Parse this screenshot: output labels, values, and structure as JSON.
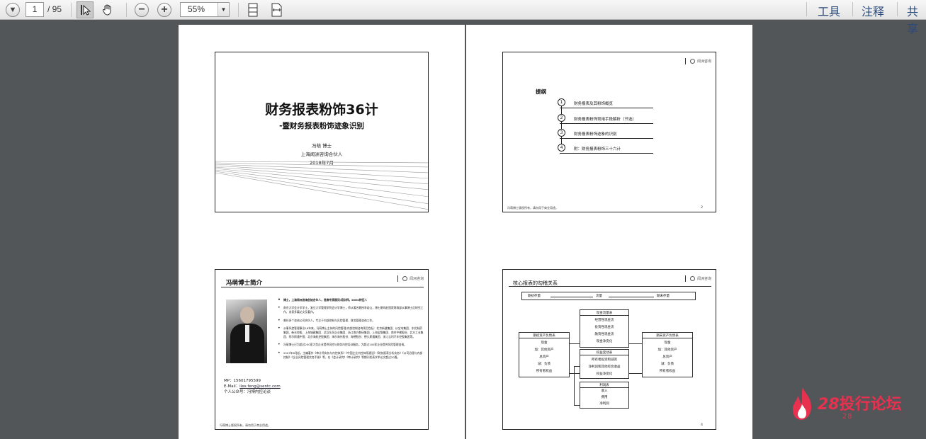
{
  "toolbar": {
    "page_current": "1",
    "page_total": "/ 95",
    "zoom": "55%",
    "menus": [
      "工具",
      "注释",
      "共享"
    ]
  },
  "slide1": {
    "title": "财务报表粉饰36计",
    "subtitle": "-暨财务报表粉饰迹象识别",
    "author": "冯萌 博士",
    "org": "上海闻洲咨询合伙人",
    "date": "2018年7月"
  },
  "slide2": {
    "heading": "提纲",
    "items": [
      {
        "num": "1",
        "text": "财务报表及其粉饰概览"
      },
      {
        "num": "2",
        "text": "财务报表粉饰常用手段解析（节选）"
      },
      {
        "num": "3",
        "text": "财务报表粉饰迹象的识别"
      },
      {
        "num": "4",
        "text": "附：财务报表粉饰三十六计"
      }
    ],
    "page_no": "2"
  },
  "slide3": {
    "title": "冯萌博士简介",
    "contact_mp": "MP：15601795599",
    "contact_email_label": "E-Mail：",
    "contact_email": "ilex.feng@sentc.com",
    "contact_wechat": "个人公众号：冯博内控论谈",
    "bullets": [
      "博士，上海闻洲咨询创始合伙人，首席专家顾问/培训师，DIOS特征人",
      "南京大学会计学学士，复旦大学管理学院会计学博士，师从著名教授李若山，博士期间赴国家财政部从事博士后研究工作，发表多篇论文及著作。",
      "曾任多个咨询公司合伙人，专注于内部控制与风险管理、财务管理咨询工作。",
      "从事风控管理事业16年来，冯萌博士主持的风险管理/内部控制咨询项目包括：北京新道集团、炒宝岛集团、东北制药集团、新光控股、上海城建集团、武汉东风企业集团、浙江南方数码集团、上海宝钢集团、南京中粮股份、北方工业集团、阿尔斯通中国、北京海航控股集团、海尔海外股份、海德股份、德久斯通集团、浙江吉利汽车控股集团等。",
      "冯萌博士已为超过200家大型企业提供风控与财务内控培训服务，为超过100家企业提供风险管理咨询。",
      "2007年8月起，主编著作《审计师实务与内控体系》《中国企业内控体系建设》《财务报表分析实务》《公司治理与内部控制》《企业风险管理实务手册》等，在《会计研究》《审计研究》等期刊发表学术论文超过20篇。"
    ],
    "footer": "冯萌博士版权所有，请勿用于商业用途。"
  },
  "slide4": {
    "title": "核心报表的勾稽关系",
    "top_left": "期初存量",
    "top_mid": "流量",
    "top_right": "期末存量",
    "left_box": [
      "期初资产负债表",
      "现金",
      "加：其他资产",
      "总资产",
      "减：负债",
      "所有者权益"
    ],
    "cash_box": [
      "现金流量表",
      "经营性现金流",
      "投资性现金流",
      "融资性现金流",
      "现金净变化"
    ],
    "equity_box": [
      "权益变动表",
      "所有者投资和减资",
      "净利润和其他综合收益",
      "权益净变化"
    ],
    "right_box": [
      "期末资产负债表",
      "现金",
      "加：其他资产",
      "总资产",
      "减：负债",
      "所有者权益"
    ],
    "income_box": [
      "利润表",
      "收入",
      "费用",
      "净利润"
    ],
    "page_no": "4"
  },
  "watermark": {
    "brand_num": "28",
    "brand_cn": "投行论坛",
    "url_pre": "www.",
    "url_red": "28",
    "url_post": "touhang.com"
  }
}
